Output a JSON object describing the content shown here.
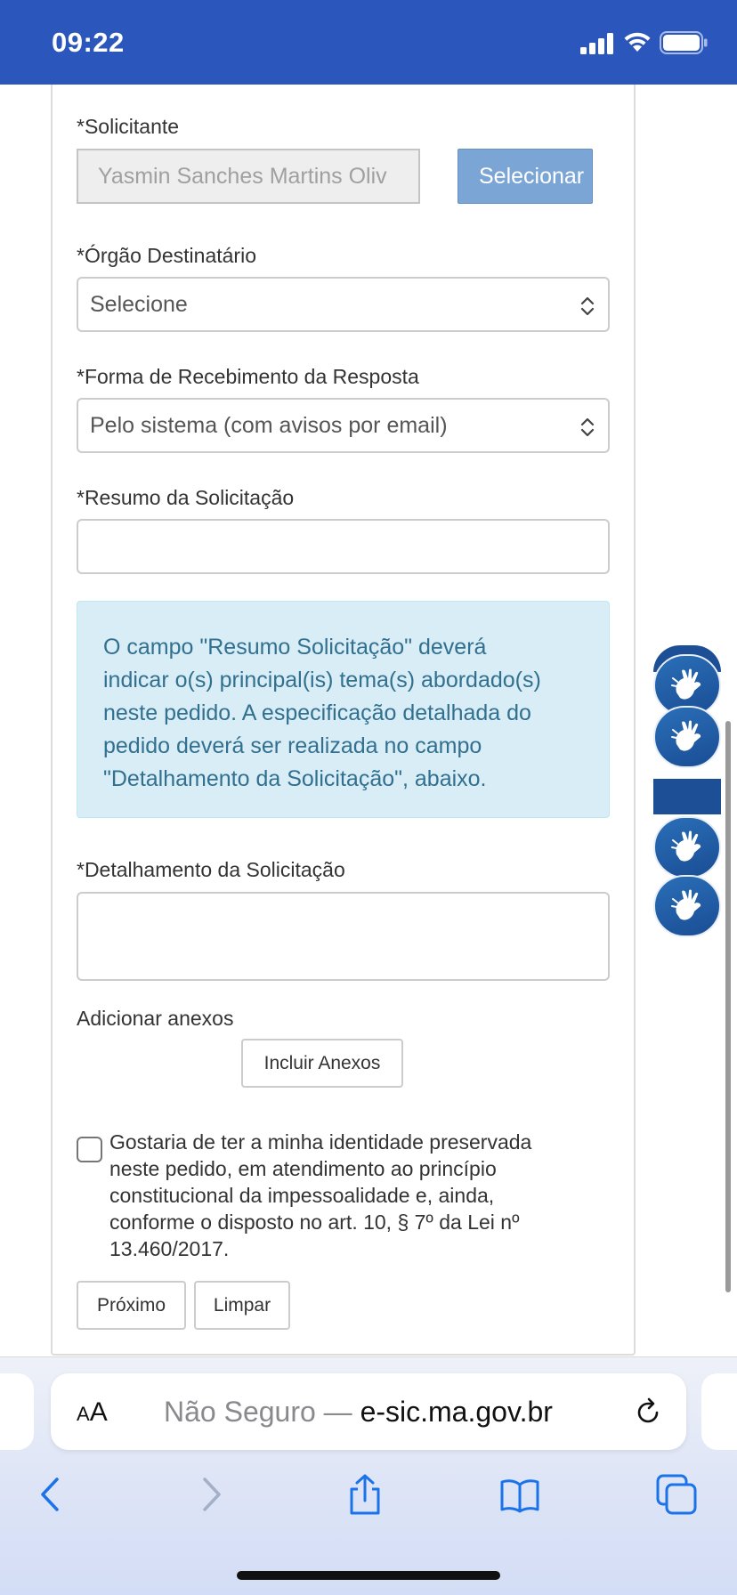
{
  "status_bar": {
    "time": "09:22"
  },
  "form": {
    "solicitante": {
      "label": "*Solicitante",
      "value": "Yasmin Sanches Martins Oliv",
      "button": "Selecionar"
    },
    "orgao": {
      "label": "*Órgão Destinatário",
      "value": "Selecione"
    },
    "forma": {
      "label": "*Forma de Recebimento da Resposta",
      "value": "Pelo sistema (com avisos por email)"
    },
    "resumo": {
      "label": "*Resumo da Solicitação",
      "value": ""
    },
    "info_lines": [
      "O campo \"Resumo Solicitação\" deverá",
      "indicar o(s) principal(is) tema(s) abordado(s)",
      "neste pedido. A especificação detalhada do",
      "pedido deverá ser realizada no campo",
      "\"Detalhamento da Solicitação\", abaixo."
    ],
    "detalhamento": {
      "label": "*Detalhamento da Solicitação",
      "value": ""
    },
    "anexos": {
      "label": "Adicionar anexos",
      "button": "Incluir Anexos"
    },
    "identity_checkbox": {
      "checked": false,
      "lines": [
        "Gostaria de ter a minha identidade preservada",
        "neste pedido, em atendimento ao princípio",
        "constitucional da impessoalidade e, ainda,",
        "conforme o disposto no art. 10, § 7º da Lei nº",
        "13.460/2017."
      ]
    },
    "actions": {
      "next": "Próximo",
      "clear": "Limpar"
    }
  },
  "browser": {
    "aa_big": "A",
    "aa_small": "A",
    "url_prefix": "Não Seguro — ",
    "url_domain": "e-sic.ma.gov.br",
    "icons": [
      "back-icon",
      "forward-icon",
      "share-icon",
      "bookmarks-icon",
      "tabs-icon",
      "reload-icon"
    ]
  },
  "colors": {
    "status_bar": "#2b57bd",
    "select_button": "#7ba5d4",
    "info_bg": "#d9edf7",
    "info_text": "#31708f",
    "ios_blue": "#1a73e8",
    "widget": "#1d4f97"
  }
}
